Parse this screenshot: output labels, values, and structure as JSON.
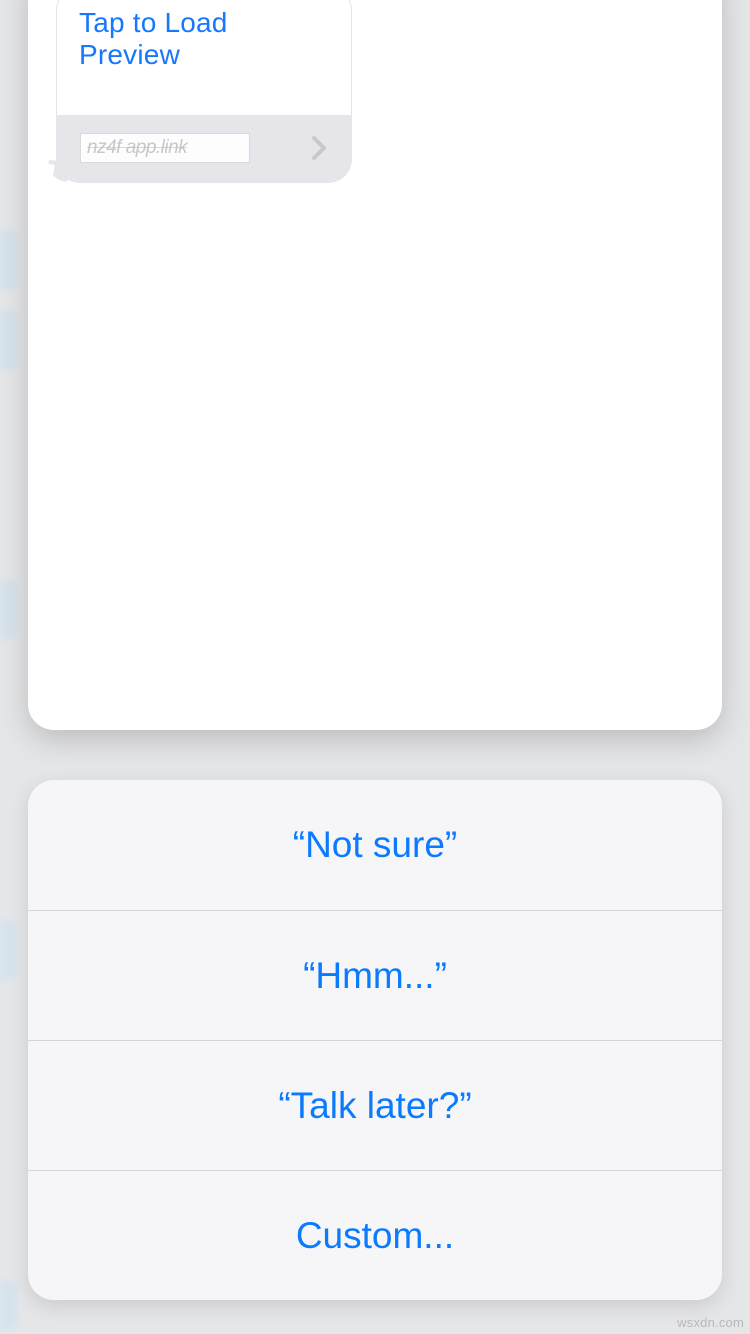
{
  "message": {
    "preview_label": "Tap to Load Preview",
    "url_text": "nz4f app.link"
  },
  "quick_replies": {
    "items": [
      "“Not sure”",
      "“Hmm...”",
      "“Talk later?”",
      "Custom..."
    ]
  },
  "watermark": "wsxdn.com"
}
